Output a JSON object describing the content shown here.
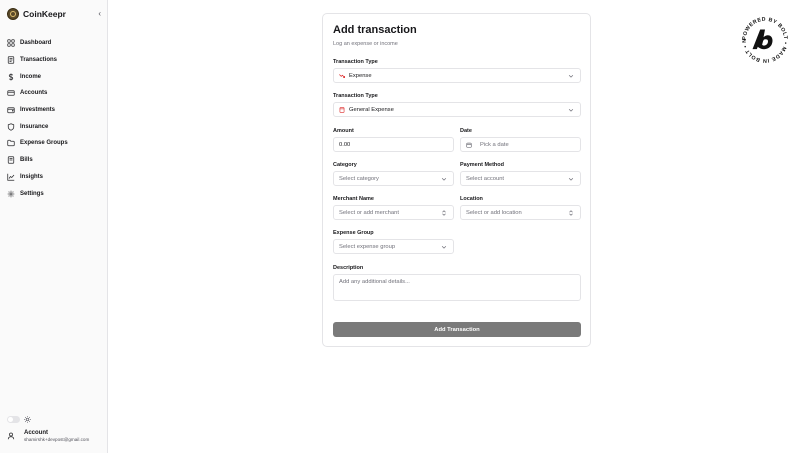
{
  "app": {
    "name": "CoinKeepr"
  },
  "sidebar": {
    "items": [
      {
        "label": "Dashboard",
        "icon": "dashboard-icon"
      },
      {
        "label": "Transactions",
        "icon": "receipt-icon"
      },
      {
        "label": "Income",
        "icon": "dollar-icon"
      },
      {
        "label": "Accounts",
        "icon": "credit-card-icon"
      },
      {
        "label": "Investments",
        "icon": "wallet-icon"
      },
      {
        "label": "Insurance",
        "icon": "shield-icon"
      },
      {
        "label": "Expense Groups",
        "icon": "folder-icon"
      },
      {
        "label": "Bills",
        "icon": "bill-icon"
      },
      {
        "label": "Insights",
        "icon": "chart-icon"
      },
      {
        "label": "Settings",
        "icon": "gear-icon"
      }
    ],
    "account": {
      "title": "Account",
      "email": "shamirshk+devpost@gmail.com"
    }
  },
  "form": {
    "title": "Add transaction",
    "subtitle": "Log an expense or income",
    "transaction_type_label": "Transaction Type",
    "transaction_type_value": "Expense",
    "transaction_type2_label": "Transaction Type",
    "transaction_type2_value": "General Expense",
    "amount_label": "Amount",
    "amount_placeholder": "0.00",
    "date_label": "Date",
    "date_placeholder": "Pick a date",
    "category_label": "Category",
    "category_placeholder": "Select category",
    "payment_label": "Payment Method",
    "payment_placeholder": "Select account",
    "merchant_label": "Merchant Name",
    "merchant_placeholder": "Select or add merchant",
    "location_label": "Location",
    "location_placeholder": "Select or add location",
    "expense_group_label": "Expense Group",
    "expense_group_placeholder": "Select expense group",
    "description_label": "Description",
    "description_placeholder": "Add any additional details...",
    "submit_label": "Add Transaction"
  },
  "badge": {
    "text": "POWERED BY BOLT • MADE IN BOLT • NEW •"
  },
  "colors": {
    "expense_red": "#dc2626",
    "button_gray": "#7a7a7a",
    "border": "#e4e4e7"
  }
}
